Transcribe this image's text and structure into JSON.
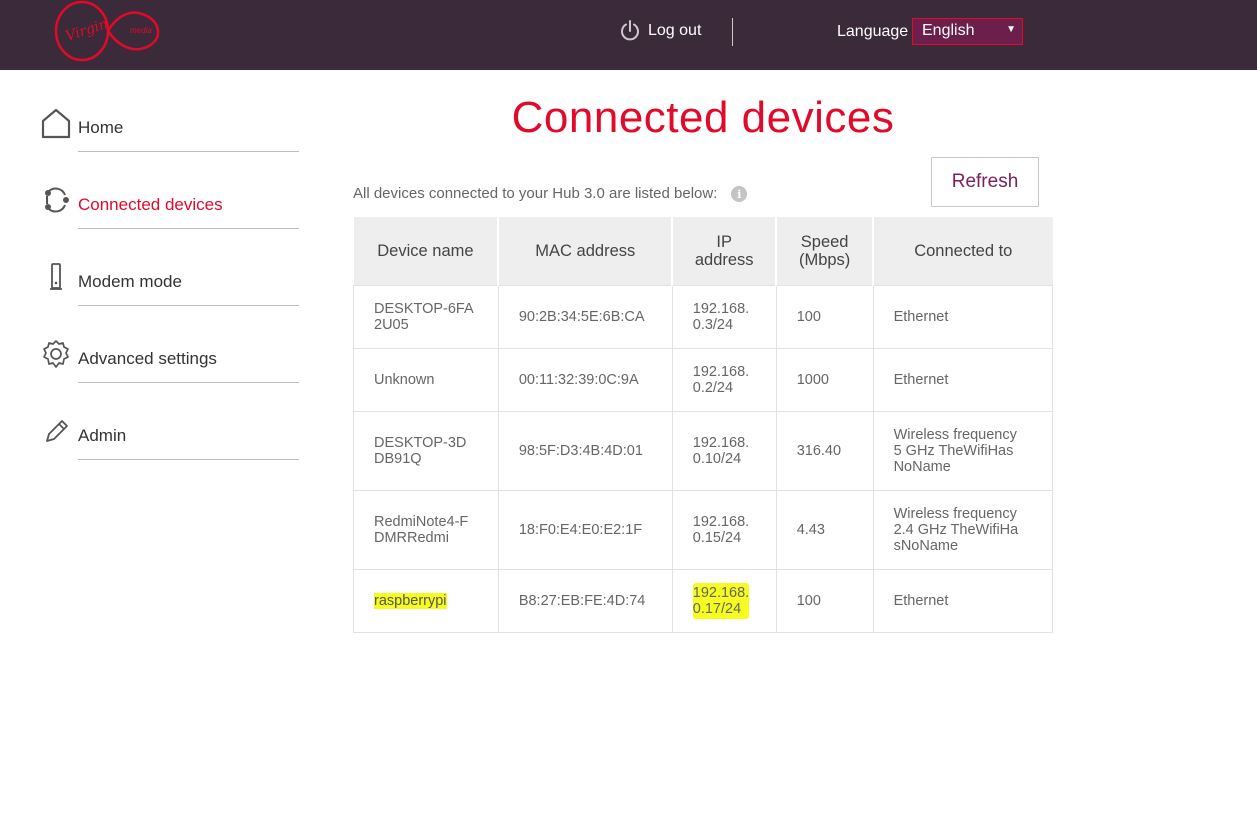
{
  "header": {
    "brand": {
      "logo_text_primary": "Virgin",
      "logo_text_secondary": "media"
    },
    "logout_label": "Log out",
    "logout_icon": "power-icon",
    "language_label": "Language",
    "language_selected": "English",
    "colors": {
      "background": "#3b2a39",
      "accent": "#e10a2a"
    }
  },
  "sidebar": {
    "items": [
      {
        "label": "Home",
        "icon": "home-icon",
        "active": false
      },
      {
        "label": "Connected devices",
        "icon": "devices-icon",
        "active": true
      },
      {
        "label": "Modem mode",
        "icon": "modem-icon",
        "active": false
      },
      {
        "label": "Advanced settings",
        "icon": "gear-icon",
        "active": false
      },
      {
        "label": "Admin",
        "icon": "pencil-icon",
        "active": false
      }
    ]
  },
  "main": {
    "title": "Connected devices",
    "subtitle": "All devices connected to your Hub 3.0 are listed below:",
    "info_icon": "info-icon",
    "refresh_label": "Refresh",
    "table": {
      "headers": {
        "device_name": "Device name",
        "mac": "MAC address",
        "ip_line1": "IP",
        "ip_line2": "address",
        "speed_line1": "Speed",
        "speed_line2": "(Mbps)",
        "connected_to": "Connected to"
      },
      "rows": [
        {
          "name_l1": "DESKTOP-6FA",
          "name_l2": "2U05",
          "mac": "90:2B:34:5E:6B:CA",
          "ip_l1": "192.168.",
          "ip_l2": "0.3/24",
          "speed": "100",
          "conn_l1": "Ethernet",
          "conn_l2": "",
          "conn_l3": ""
        },
        {
          "name_l1": "Unknown",
          "name_l2": "",
          "mac": "00:11:32:39:0C:9A",
          "ip_l1": "192.168.",
          "ip_l2": "0.2/24",
          "speed": "1000",
          "conn_l1": "Ethernet",
          "conn_l2": "",
          "conn_l3": ""
        },
        {
          "name_l1": "DESKTOP-3D",
          "name_l2": "DB91Q",
          "mac": "98:5F:D3:4B:4D:01",
          "ip_l1": "192.168.",
          "ip_l2": "0.10/24",
          "speed": "316.40",
          "conn_l1": "Wireless frequency",
          "conn_l2": "5 GHz TheWifiHas",
          "conn_l3": "NoName"
        },
        {
          "name_l1": "RedmiNote4-F",
          "name_l2": "DMRRedmi",
          "mac": "18:F0:E4:E0:E2:1F",
          "ip_l1": "192.168.",
          "ip_l2": "0.15/24",
          "speed": "4.43",
          "conn_l1": "Wireless frequency",
          "conn_l2": "2.4 GHz TheWifiHa",
          "conn_l3": "sNoName"
        },
        {
          "name_l1": "raspberrypi",
          "name_l2": "",
          "mac": "B8:27:EB:FE:4D:74",
          "ip_l1": "192.168.",
          "ip_l2": "0.17/24",
          "speed": "100",
          "conn_l1": "Ethernet",
          "conn_l2": "",
          "conn_l3": "",
          "highlighted": true,
          "highlight_color": "#f6fb20"
        }
      ]
    }
  }
}
